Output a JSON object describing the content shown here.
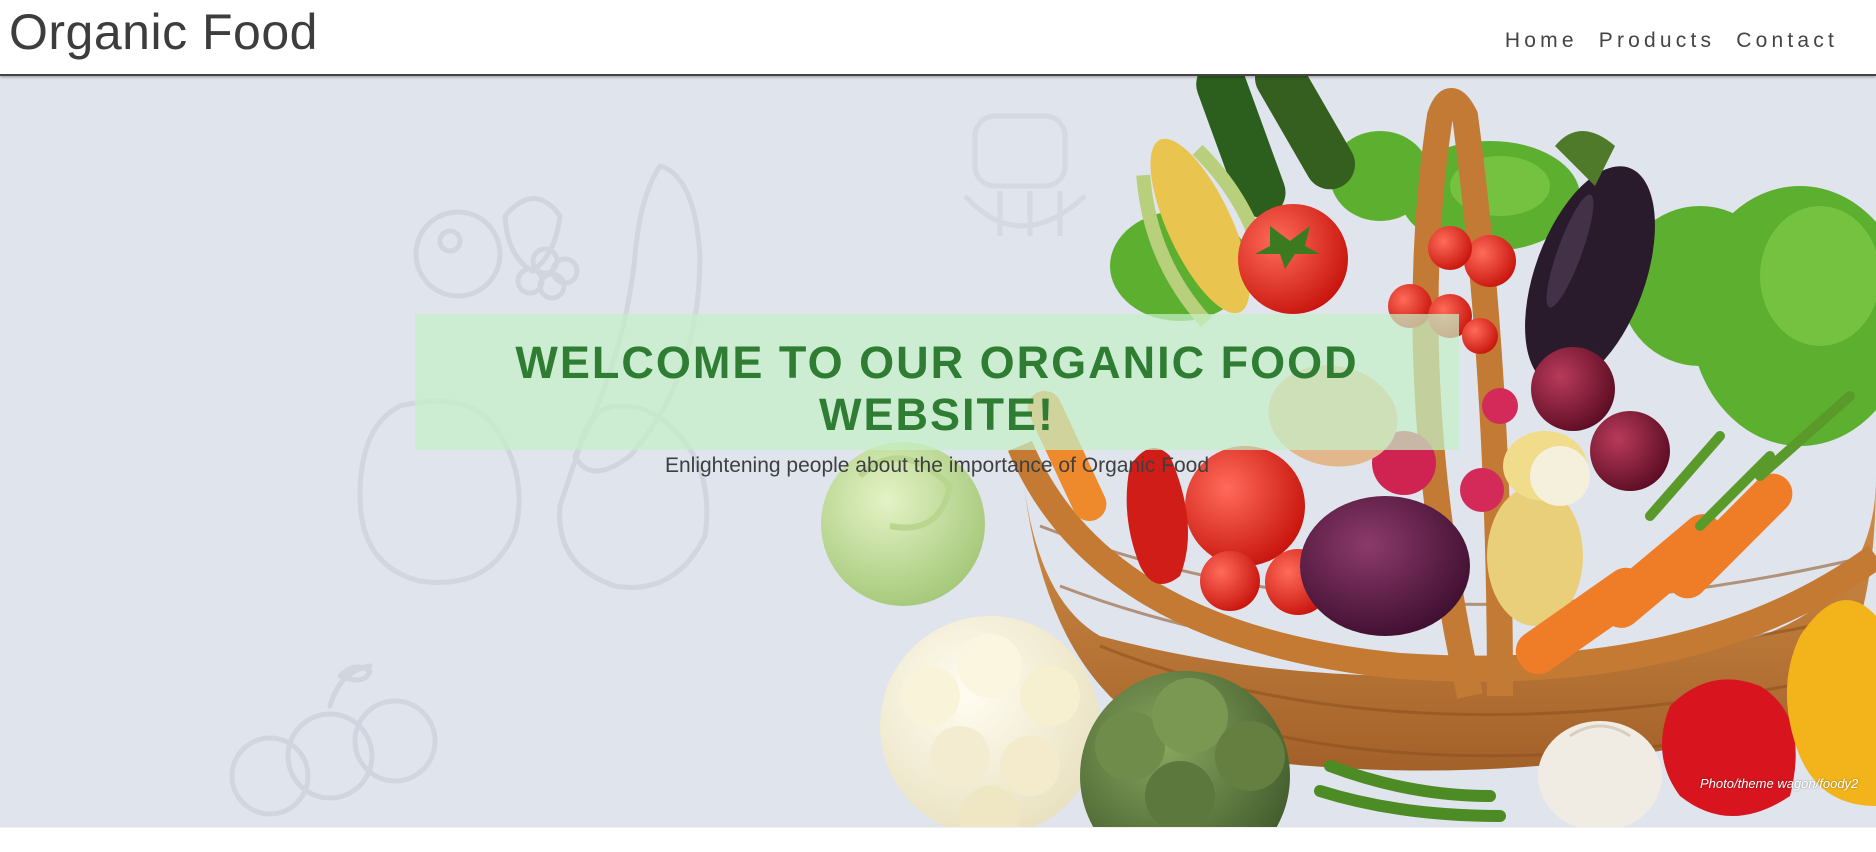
{
  "header": {
    "title": "Organic Food",
    "nav": [
      "Home",
      "Products",
      "Contact"
    ]
  },
  "hero": {
    "heading": "WELCOME TO OUR ORGANIC FOOD WEBSITE!",
    "subheading": "Enlightening people about the importance of Organic Food",
    "photo_credit": "Photo/theme wagon/foody2"
  },
  "colors": {
    "heading_green": "#2e7d32",
    "hero_background": "#e0e4ec",
    "overlay_green": "#c5f0c8"
  },
  "icons": [
    "vegetable-basket-image",
    "vegetable-doodle-icons"
  ]
}
